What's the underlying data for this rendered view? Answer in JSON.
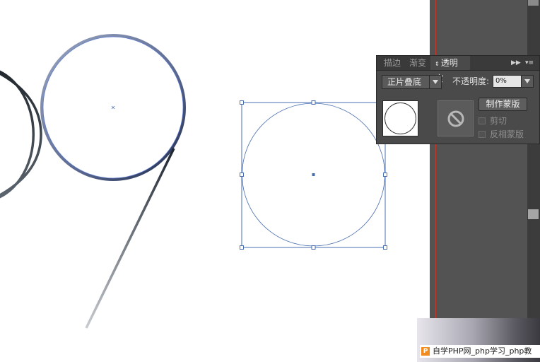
{
  "panel": {
    "tabs": [
      {
        "label": "描边",
        "active": false
      },
      {
        "label": "渐变",
        "active": false
      },
      {
        "label": "透明度",
        "active": true
      }
    ],
    "blend_mode": "正片叠底",
    "opacity_label": "不透明度:",
    "opacity_value": "0%",
    "make_mask_label": "制作蒙版",
    "clip_label": "剪切",
    "invert_mask_label": "反相蒙版"
  },
  "watermark": {
    "logo_letter": "P",
    "text": "自学PHP网_php学习_php教"
  },
  "colors": {
    "selection_blue": "#4a6fb0",
    "panel_bg": "#4a4a4a",
    "canvas_bg": "#535353",
    "guide_red": "#c0392b"
  },
  "icons": [
    "collapse-arrows-icon",
    "panel-menu-icon",
    "dropdown-arrow-icon",
    "no-mask-icon"
  ]
}
